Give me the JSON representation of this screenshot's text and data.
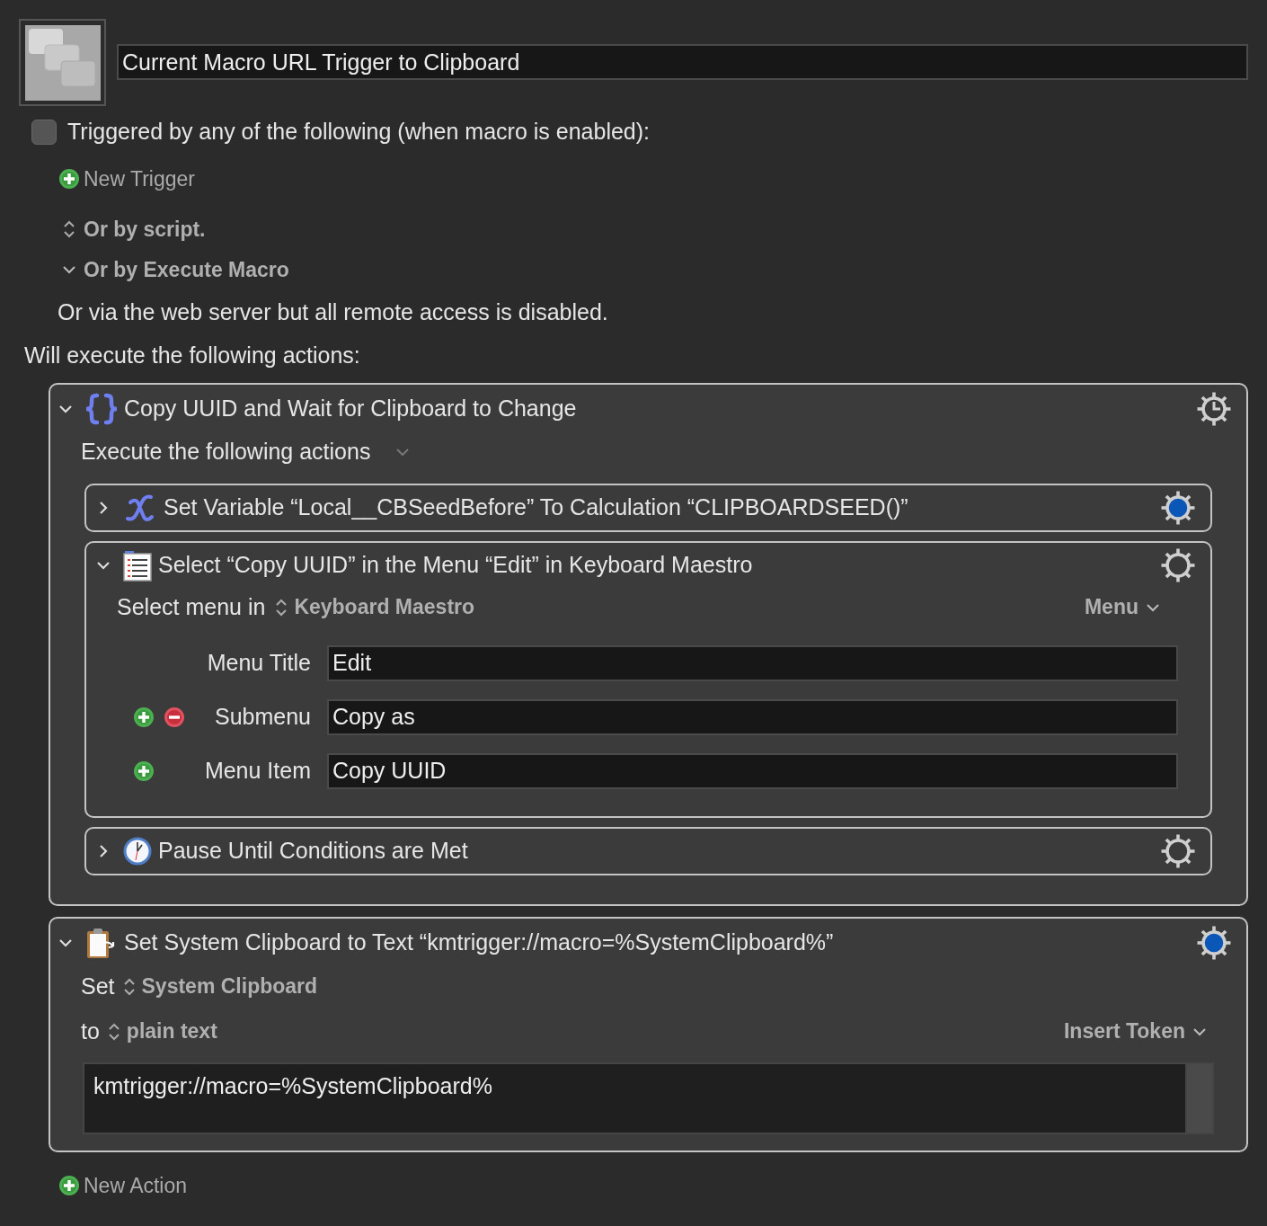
{
  "macro": {
    "title": "Current Macro URL Trigger to Clipboard"
  },
  "triggers": {
    "checked": false,
    "label": "Triggered by any of the following (when macro is enabled):",
    "new_trigger": "New Trigger",
    "script_option": "Or by script.",
    "execute_macro_option": "Or by Execute Macro",
    "web_server_note": "Or via the web server but all remote access is disabled."
  },
  "actions_heading": "Will execute the following actions:",
  "actions": [
    {
      "kind": "group",
      "title": "Copy UUID and Wait for Clipboard to Change",
      "expanded": true,
      "gear_clock": true,
      "gear_highlighted": false,
      "mode_label": "Execute the following actions",
      "children": [
        {
          "kind": "variable",
          "title": "Set Variable “Local__CBSeedBefore” To Calculation “CLIPBOARDSEED()”",
          "expanded": false,
          "gear_clock": false,
          "gear_highlighted": true
        },
        {
          "kind": "menu",
          "title": "Select “Copy UUID” in the Menu “Edit” in Keyboard Maestro",
          "expanded": true,
          "gear_clock": false,
          "gear_highlighted": false,
          "select_label": "Select menu in",
          "app": "Keyboard Maestro",
          "menu_button": "Menu",
          "fields": [
            {
              "label": "Menu Title",
              "value": "Edit"
            },
            {
              "label": "Submenu",
              "value": "Copy as",
              "controls": [
                {
                  "kind": "add"
                },
                {
                  "kind": "remove"
                }
              ]
            },
            {
              "label": "Menu Item",
              "value": "Copy UUID",
              "controls": [
                {
                  "kind": "add"
                }
              ]
            }
          ]
        },
        {
          "kind": "pause",
          "title": "Pause Until Conditions are Met",
          "expanded": false,
          "gear_clock": false,
          "gear_highlighted": false
        }
      ]
    },
    {
      "kind": "clipboard",
      "title": "Set System Clipboard to Text “kmtrigger://macro=%SystemClipboard%”",
      "expanded": true,
      "gear_clock": false,
      "gear_highlighted": true,
      "set_label": "Set",
      "target": "System Clipboard",
      "to_label": "to",
      "format": "plain text",
      "token_button": "Insert Token",
      "text": "kmtrigger://macro=%SystemClipboard%"
    }
  ],
  "new_action": "New Action"
}
